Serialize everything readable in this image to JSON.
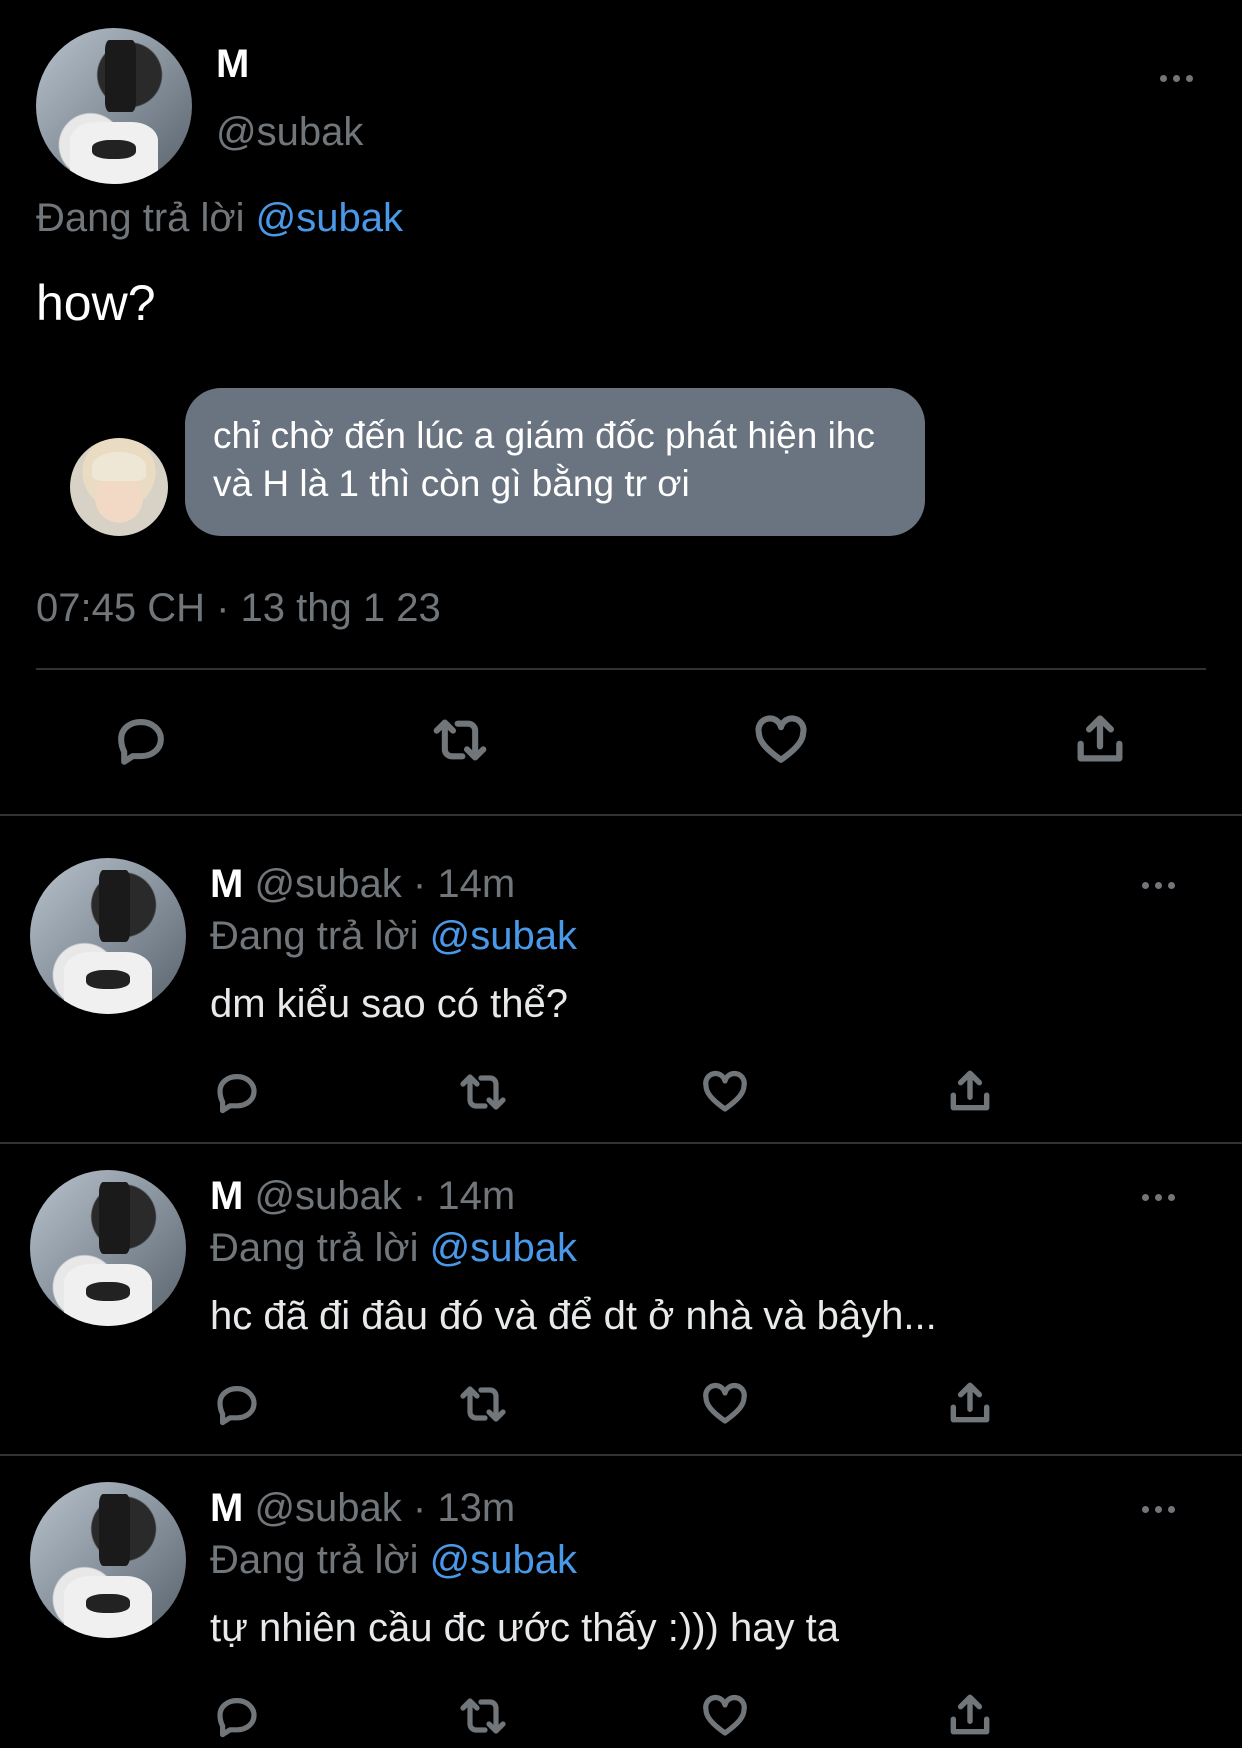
{
  "main_tweet": {
    "display_name": "M",
    "handle": "@subak",
    "replying_to_label": "Đang trả lời",
    "replying_to_handle": "@subak",
    "text": "how?",
    "quoted_message": "chỉ chờ đến lúc a giám đốc phát hiện ihc và H là 1 thì còn gì bằng tr ơi",
    "timestamp": "07:45 CH · 13 thg 1 23"
  },
  "replies": [
    {
      "display_name": "M",
      "handle": "@subak",
      "time": "· 14m",
      "replying_to_label": "Đang trả lời",
      "replying_to_handle": "@subak",
      "text": "dm kiểu sao có thể?"
    },
    {
      "display_name": "M",
      "handle": "@subak",
      "time": "· 14m",
      "replying_to_label": "Đang trả lời",
      "replying_to_handle": "@subak",
      "text": "hc đã đi đâu đó và để dt ở nhà và bâyh..."
    },
    {
      "display_name": "M",
      "handle": "@subak",
      "time": "· 13m",
      "replying_to_label": "Đang trả lời",
      "replying_to_handle": "@subak",
      "text": "tự nhiên cầu đc ước thấy :))) hay ta"
    }
  ],
  "icons": {
    "more": "more-icon",
    "reply": "reply-icon",
    "retweet": "retweet-icon",
    "like": "like-icon",
    "share": "share-icon"
  },
  "colors": {
    "background": "#000000",
    "text": "#e7e9ea",
    "muted": "#71767b",
    "link": "#4a99e9",
    "bubble": "#6a7480",
    "divider": "#2f3336"
  }
}
